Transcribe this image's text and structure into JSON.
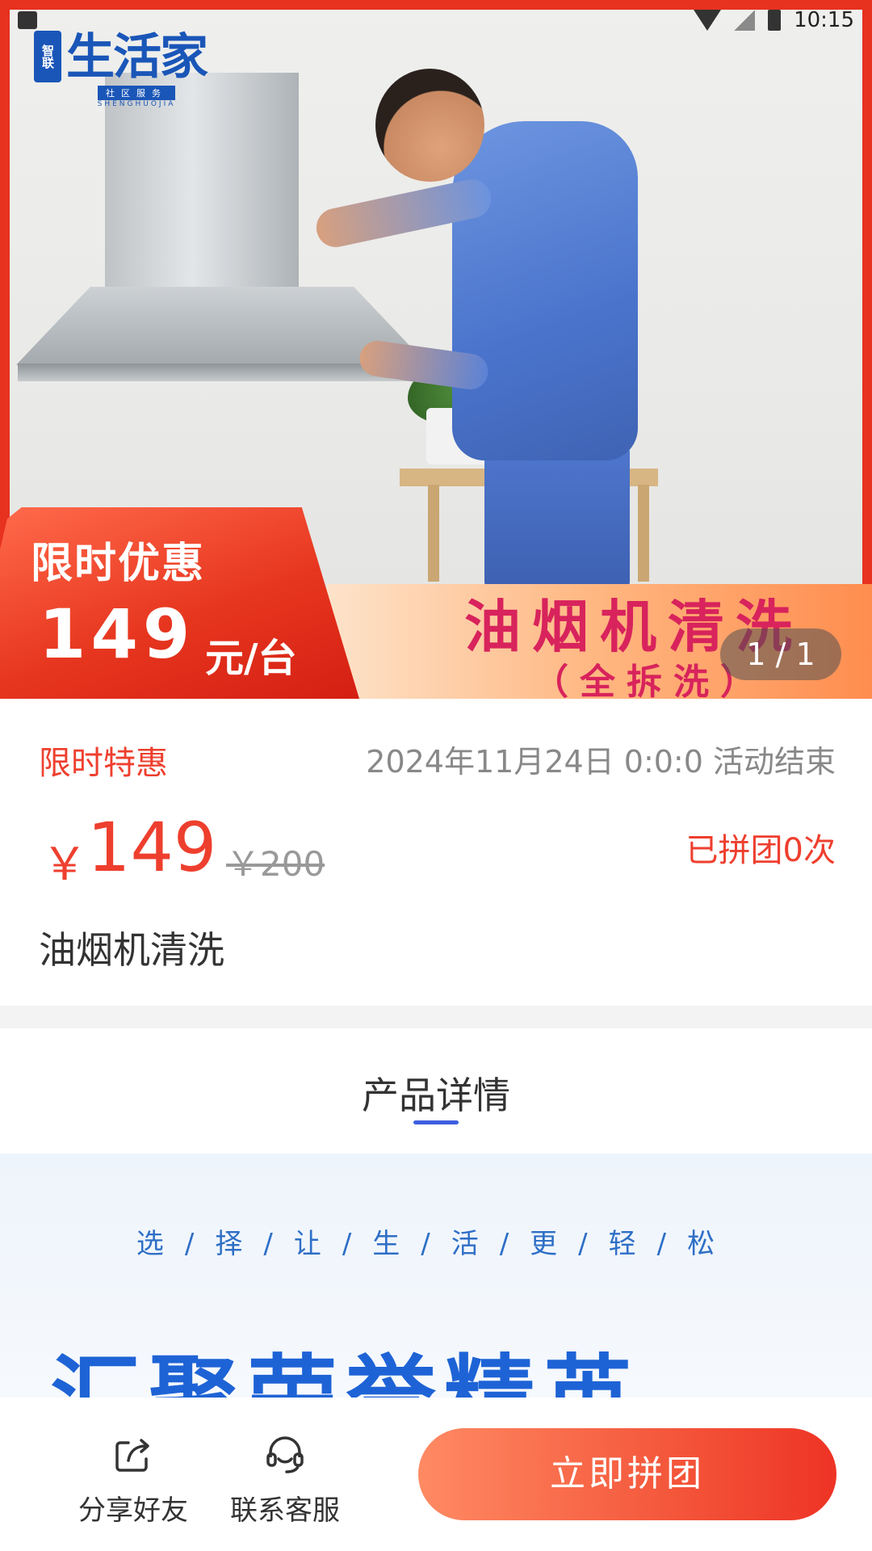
{
  "status_bar": {
    "time": "10:15"
  },
  "banner": {
    "brand_name": "生活家",
    "brand_tag": "社区服务",
    "brand_seal": "智联",
    "brand_sub": "SHENGHUOJIA",
    "promo_title": "限时优惠",
    "promo_price": "149",
    "promo_unit": "元/台",
    "service_title": "油烟机清洗",
    "service_subtitle": "（全拆洗）",
    "page_indicator": "1 / 1"
  },
  "product": {
    "flash_label": "限时特惠",
    "end_time": "2024年11月24日 0:0:0 活动结束",
    "currency": "￥",
    "price": "149",
    "original_price": "￥200",
    "group_count": "已拼团0次",
    "name": "油烟机清洗"
  },
  "tabs": {
    "detail_label": "产品详情"
  },
  "detail": {
    "slogan": "选/择/让/生/活/更/轻/松",
    "headline": "汇聚荣誉精英"
  },
  "bottom_bar": {
    "share_label": "分享好友",
    "service_label": "联系客服",
    "cta_label": "立即拼团"
  },
  "colors": {
    "accent_red": "#ee3f2e",
    "brand_blue": "#1a56b8",
    "tab_indicator": "#3d5fe0"
  }
}
